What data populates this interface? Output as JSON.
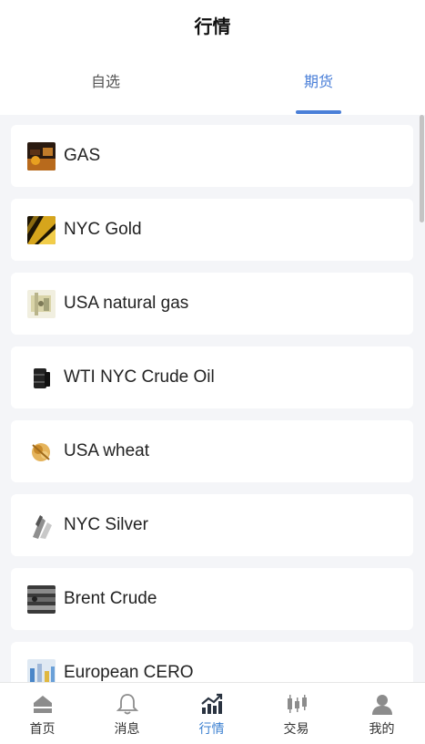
{
  "header": {
    "title": "行情"
  },
  "tabs": [
    {
      "label": "自选",
      "active": false
    },
    {
      "label": "期货",
      "active": true
    }
  ],
  "accent_color": "#4a7fd8",
  "items": [
    {
      "name": "GAS",
      "icon": "gas-thumbnail"
    },
    {
      "name": "NYC Gold",
      "icon": "gold-thumbnail"
    },
    {
      "name": "USA natural gas",
      "icon": "natural-gas-thumbnail"
    },
    {
      "name": "WTI NYC Crude Oil",
      "icon": "crude-oil-thumbnail"
    },
    {
      "name": "USA wheat",
      "icon": "wheat-thumbnail"
    },
    {
      "name": "NYC Silver",
      "icon": "silver-thumbnail"
    },
    {
      "name": "Brent Crude",
      "icon": "brent-crude-thumbnail"
    },
    {
      "name": "European CERO",
      "icon": "cero-thumbnail"
    }
  ],
  "bottom_nav": [
    {
      "label": "首页",
      "icon": "home-icon",
      "active": false
    },
    {
      "label": "消息",
      "icon": "bell-icon",
      "active": false
    },
    {
      "label": "行情",
      "icon": "chart-icon",
      "active": true
    },
    {
      "label": "交易",
      "icon": "candlestick-icon",
      "active": false
    },
    {
      "label": "我的",
      "icon": "user-icon",
      "active": false
    }
  ]
}
